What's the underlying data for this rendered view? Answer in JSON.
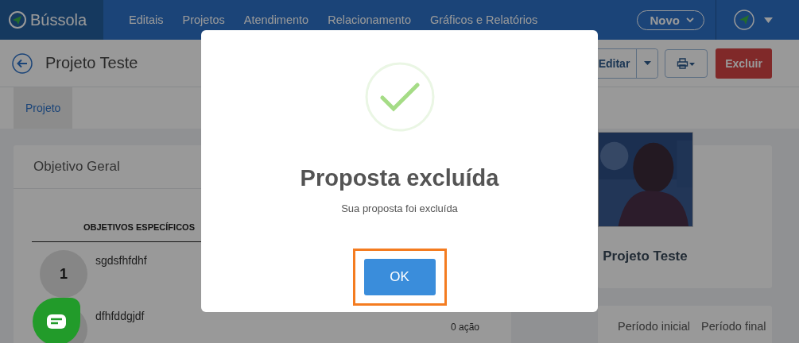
{
  "header": {
    "brand": "Bússola",
    "nav": [
      {
        "label": "Editais"
      },
      {
        "label": "Projetos"
      },
      {
        "label": "Atendimento"
      },
      {
        "label": "Relacionamento"
      },
      {
        "label": "Gráficos e Relatórios"
      }
    ],
    "new_button": "Novo"
  },
  "toolbar": {
    "title": "Projeto Teste",
    "edit_button": "Editar",
    "delete_button": "Excluir"
  },
  "tabs": [
    {
      "label": "Projeto",
      "selected": true
    }
  ],
  "objectives": {
    "title": "Objetivo Geral",
    "column_header": "OBJETIVOS ESPECÍFICOS",
    "items": [
      {
        "number": "1",
        "text": "sgdsfhfdhf"
      },
      {
        "text": "dfhfddgjdf",
        "actions": "0 ação"
      }
    ]
  },
  "project_card": {
    "name": "Projeto Teste"
  },
  "period": {
    "start_label": "Período inicial",
    "end_label": "Período final"
  },
  "dialog": {
    "title": "Proposta excluída",
    "message": "Sua proposta foi excluída",
    "ok_button": "OK",
    "highlighted": true
  }
}
